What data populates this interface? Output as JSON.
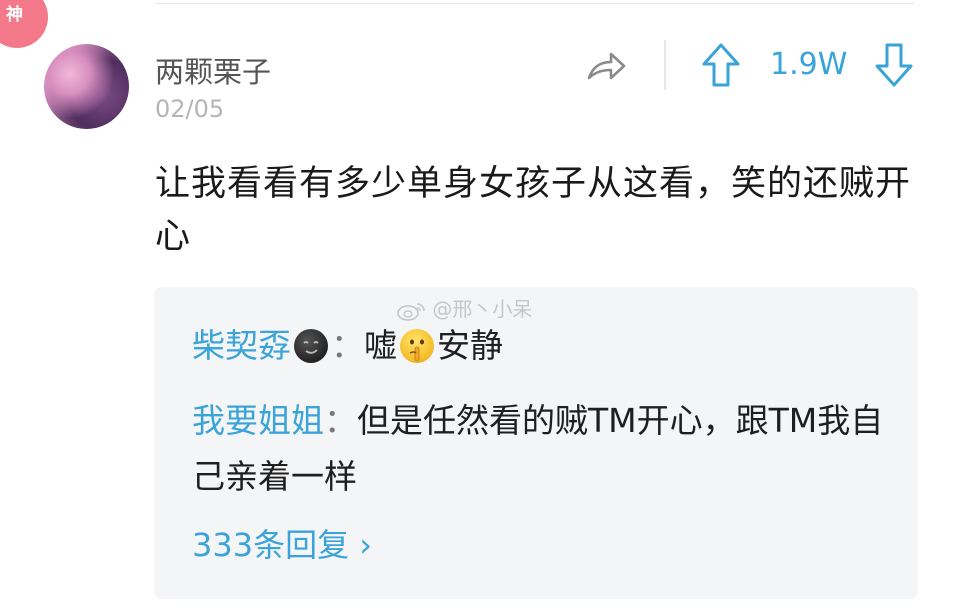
{
  "badge": {
    "label": "神"
  },
  "post": {
    "username": "两颗栗子",
    "date": "02/05",
    "vote_count": "1.9W",
    "text": "让我看看有多少单身女孩子从这看，笑的还贼开心"
  },
  "icons": {
    "share": "share-arrow-icon",
    "upvote": "upvote-arrow-icon",
    "downvote": "downvote-arrow-icon"
  },
  "watermark": "@邢丶小呆",
  "replies": [
    {
      "nick": "柴契孬",
      "separator": "：",
      "text_before": "嘘",
      "text_after": "安静"
    },
    {
      "nick": "我要姐姐",
      "separator": "：",
      "text": "但是任然看的贼TM开心，跟TM我自己亲着一样"
    }
  ],
  "more_replies": "333条回复 ›",
  "colors": {
    "accent": "#3aa3d8",
    "badge": "#f3798a"
  }
}
